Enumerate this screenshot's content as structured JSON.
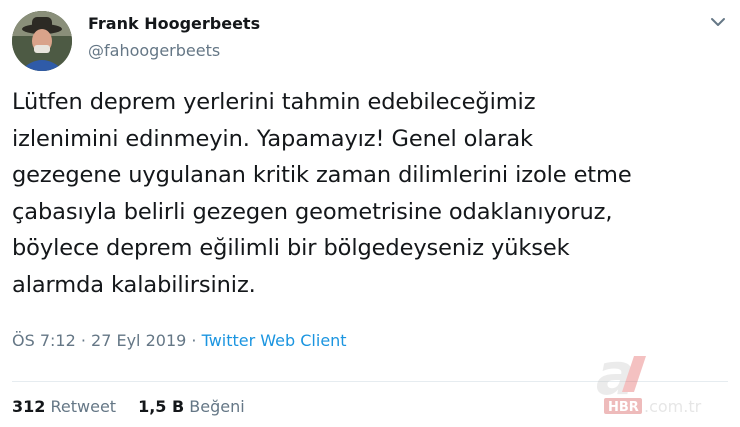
{
  "author": {
    "name": "Frank Hoogerbeets",
    "handle": "@fahoogerbeets",
    "avatar_icon": "profile-photo-man-with-hat"
  },
  "tweet_text": "Lütfen deprem yerlerini tahmin edebileceğimiz\nizlenimini edinmeyin. Yapamayız! Genel olarak\ngezegene uygulanan kritik zaman dilimlerini izole etme\nçabasıyla belirli gezegen geometrisine odaklanıyoruz,\nböylece deprem eğilimli bir bölgedeyseniz yüksek\nalarmda kalabilirsiniz.",
  "meta": {
    "time": "ÖS 7:12",
    "separator": " · ",
    "date": "27 Eyl 2019",
    "client": "Twitter Web Client"
  },
  "stats": {
    "retweets_count": "312",
    "retweets_label": "Retweet",
    "likes_count": "1,5 B",
    "likes_label": "Beğeni"
  },
  "watermark": {
    "brand": "a",
    "text": "HBR.com.tr"
  },
  "colors": {
    "text": "#14171a",
    "secondary": "#657786",
    "link": "#1b95e0"
  }
}
